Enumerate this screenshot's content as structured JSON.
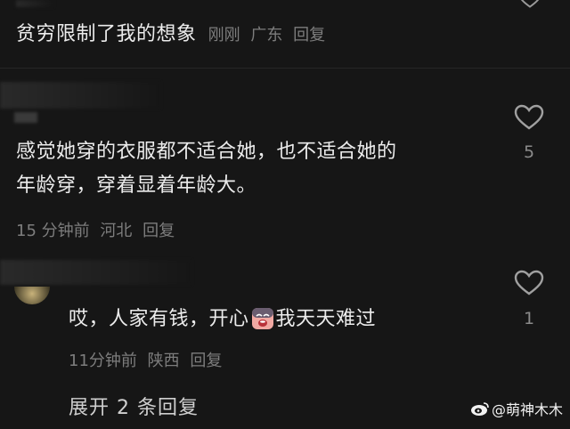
{
  "comments": [
    {
      "text": "贫穷限制了我的想象",
      "time": "刚刚",
      "location": "广东",
      "reply_label": "回复"
    },
    {
      "text_line1": "感觉她穿的衣服都不适合她，也不适合她的",
      "text_line2": "年龄穿，穿着显着年龄大。",
      "time": "15 分钟前",
      "location": "河北",
      "reply_label": "回复",
      "likes": "5"
    },
    {
      "text_before_emoji": "哎，人家有钱，开心",
      "text_after_emoji": "我天天难过",
      "emoji": "crying-face-emoji",
      "time": "11分钟前",
      "location": "陕西",
      "reply_label": "回复",
      "likes": "1"
    }
  ],
  "expand_replies": "展开 2 条回复",
  "watermark": "@萌神木木",
  "icons": {
    "like": "heart-outline-icon",
    "watermark_logo": "weibo-logo-icon"
  },
  "colors": {
    "background": "#161616",
    "text": "#ececec",
    "meta": "#7d7d7d"
  }
}
